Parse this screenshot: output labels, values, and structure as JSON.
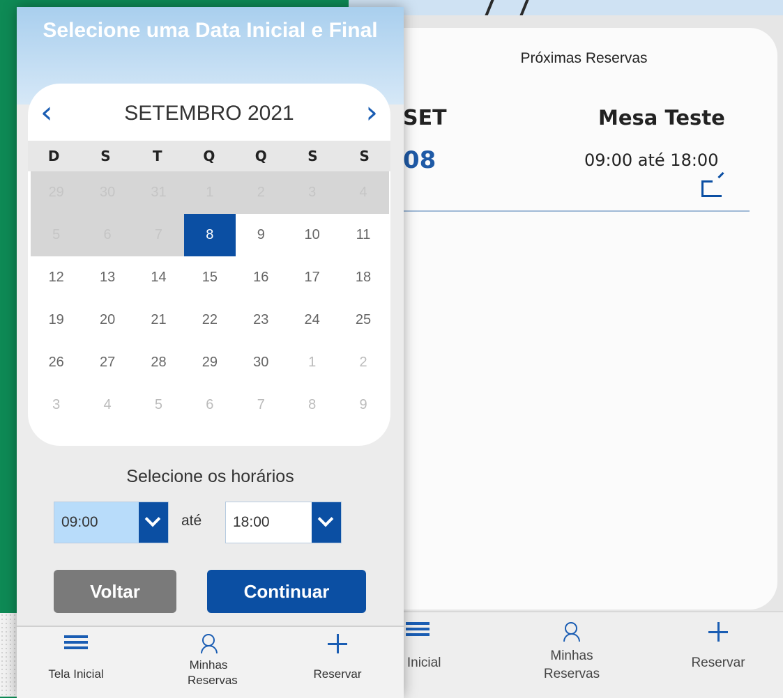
{
  "background_screen": {
    "card_title": "Próximas Reservas",
    "reservation": {
      "month": "SET",
      "day": "08",
      "name": "Mesa Teste",
      "time": "09:00 até 18:00"
    },
    "nav": {
      "home_label": "a Inicial",
      "my_reservations_label": "Minhas Reservas",
      "reserve_label": "Reservar"
    }
  },
  "modal": {
    "title": "Selecione uma Data Inicial e Final",
    "calendar": {
      "month_label": "SETEMBRO 2021",
      "weekdays": [
        "D",
        "S",
        "T",
        "Q",
        "Q",
        "S",
        "S"
      ],
      "weeks": [
        [
          {
            "d": "29",
            "s": "disabled"
          },
          {
            "d": "30",
            "s": "disabled"
          },
          {
            "d": "31",
            "s": "disabled"
          },
          {
            "d": "1",
            "s": "disabled"
          },
          {
            "d": "2",
            "s": "disabled"
          },
          {
            "d": "3",
            "s": "disabled"
          },
          {
            "d": "4",
            "s": "disabled"
          }
        ],
        [
          {
            "d": "5",
            "s": "disabled"
          },
          {
            "d": "6",
            "s": "disabled"
          },
          {
            "d": "7",
            "s": "disabled"
          },
          {
            "d": "8",
            "s": "selected"
          },
          {
            "d": "9",
            "s": "normal"
          },
          {
            "d": "10",
            "s": "normal"
          },
          {
            "d": "11",
            "s": "normal"
          }
        ],
        [
          {
            "d": "12",
            "s": "normal"
          },
          {
            "d": "13",
            "s": "normal"
          },
          {
            "d": "14",
            "s": "normal"
          },
          {
            "d": "15",
            "s": "normal"
          },
          {
            "d": "16",
            "s": "normal"
          },
          {
            "d": "17",
            "s": "normal"
          },
          {
            "d": "18",
            "s": "normal"
          }
        ],
        [
          {
            "d": "19",
            "s": "normal"
          },
          {
            "d": "20",
            "s": "normal"
          },
          {
            "d": "21",
            "s": "normal"
          },
          {
            "d": "22",
            "s": "normal"
          },
          {
            "d": "23",
            "s": "normal"
          },
          {
            "d": "24",
            "s": "normal"
          },
          {
            "d": "25",
            "s": "normal"
          }
        ],
        [
          {
            "d": "26",
            "s": "normal"
          },
          {
            "d": "27",
            "s": "normal"
          },
          {
            "d": "28",
            "s": "normal"
          },
          {
            "d": "29",
            "s": "normal"
          },
          {
            "d": "30",
            "s": "normal"
          },
          {
            "d": "1",
            "s": "other"
          },
          {
            "d": "2",
            "s": "other"
          }
        ],
        [
          {
            "d": "3",
            "s": "other"
          },
          {
            "d": "4",
            "s": "other"
          },
          {
            "d": "5",
            "s": "other"
          },
          {
            "d": "6",
            "s": "other"
          },
          {
            "d": "7",
            "s": "other"
          },
          {
            "d": "8",
            "s": "other"
          },
          {
            "d": "9",
            "s": "other"
          }
        ]
      ]
    },
    "time_label": "Selecione os horários",
    "start_time": "09:00",
    "between_label": "até",
    "end_time": "18:00",
    "back_button": "Voltar",
    "continue_button": "Continuar",
    "nav": {
      "home_label": "Tela Inicial",
      "my_reservations_label": "Minhas Reservas",
      "reserve_label": "Reservar"
    }
  },
  "colors": {
    "brand_blue": "#0b4fa3",
    "selected_start_bg": "#b8dcfa",
    "page_green": "#0e8a55"
  }
}
